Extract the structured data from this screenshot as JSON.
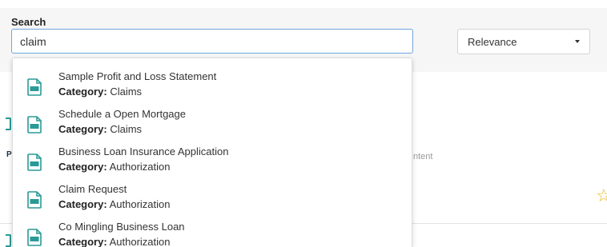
{
  "search": {
    "label": "Search",
    "value": "claim",
    "sort": "Relevance"
  },
  "suggestions": [
    {
      "title": "Sample Profit and Loss Statement",
      "category_label": "Category:",
      "category": "Claims"
    },
    {
      "title": "Schedule a Open Mortgage",
      "category_label": "Category:",
      "category": "Claims"
    },
    {
      "title": "Business Loan Insurance Application",
      "category_label": "Category:",
      "category": "Authorization"
    },
    {
      "title": "Claim Request",
      "category_label": "Category:",
      "category": "Authorization"
    },
    {
      "title": "Co Mingling Business Loan",
      "category_label": "Category:",
      "category": "Authorization"
    }
  ],
  "background": {
    "letter": "P",
    "text": "ntent"
  },
  "icons": {
    "document": "pdf-document-icon",
    "favorite": "star-icon"
  },
  "colors": {
    "icon_accent": "#2a9a96",
    "input_focus": "#6ea6de",
    "star": "#e9b820"
  }
}
